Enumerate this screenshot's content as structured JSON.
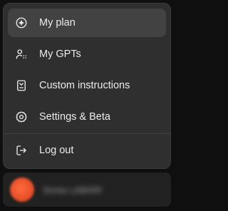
{
  "menu": {
    "items": [
      {
        "label": "My plan",
        "icon": "plan-icon",
        "active": true
      },
      {
        "label": "My GPTs",
        "icon": "gpts-icon",
        "active": false
      },
      {
        "label": "Custom instructions",
        "icon": "custom-instructions-icon",
        "active": false
      },
      {
        "label": "Settings & Beta",
        "icon": "gear-icon",
        "active": false
      },
      {
        "label": "Log out",
        "icon": "logout-icon",
        "active": false
      }
    ]
  },
  "account": {
    "avatar_color": "#e9512a",
    "name": "Sonia LABARI"
  },
  "colors": {
    "menu_bg": "#2f2f2f",
    "active_bg": "#424242",
    "text": "#ececec"
  }
}
